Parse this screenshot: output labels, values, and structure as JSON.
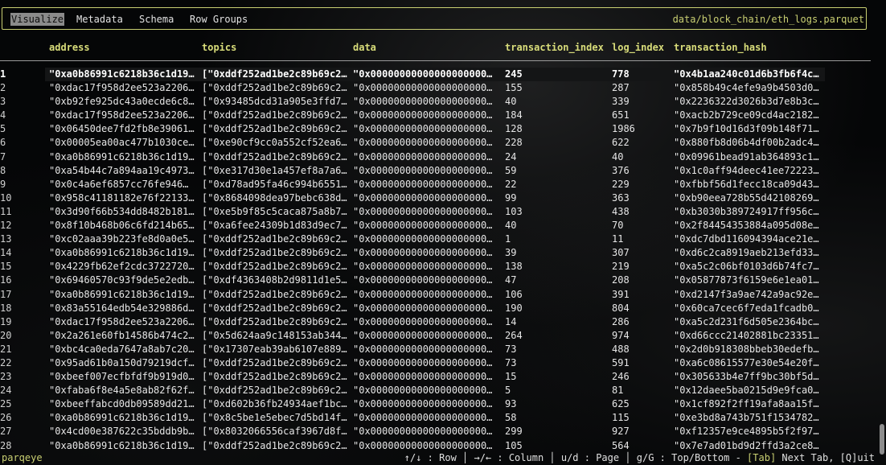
{
  "tabs": [
    {
      "label": "Visualize",
      "active": true
    },
    {
      "label": "Metadata",
      "active": false
    },
    {
      "label": "Schema",
      "active": false
    },
    {
      "label": "Row Groups",
      "active": false
    }
  ],
  "file_path": "data/block_chain/eth_logs.parquet",
  "columns": [
    "address",
    "topics",
    "data",
    "transaction_index",
    "log_index",
    "transaction_hash"
  ],
  "rows": [
    {
      "n": "1",
      "address": "\"0xa0b86991c6218b36c1d19…",
      "topics": "[\"0xddf252ad1be2c89b69c2…",
      "data": "\"0x00000000000000000000…",
      "transaction_index": "245",
      "log_index": "778",
      "transaction_hash": "\"0x4b1aa240c01d6b3fb6f4c…"
    },
    {
      "n": "2",
      "address": "\"0xdac17f958d2ee523a2206…",
      "topics": "[\"0xddf252ad1be2c89b69c2…",
      "data": "\"0x00000000000000000000…",
      "transaction_index": "155",
      "log_index": "287",
      "transaction_hash": "\"0x858b49c4efe9a9b4503d0…"
    },
    {
      "n": "3",
      "address": "\"0xb92fe925dc43a0ecde6c8…",
      "topics": "[\"0x93485dcd31a905e3ffd7…",
      "data": "\"0x00000000000000000000…",
      "transaction_index": "40",
      "log_index": "339",
      "transaction_hash": "\"0x2236322d3026b3d7e8b3c…"
    },
    {
      "n": "4",
      "address": "\"0xdac17f958d2ee523a2206…",
      "topics": "[\"0xddf252ad1be2c89b69c2…",
      "data": "\"0x00000000000000000000…",
      "transaction_index": "184",
      "log_index": "651",
      "transaction_hash": "\"0xacb2b729ce09cd4ac2182…"
    },
    {
      "n": "5",
      "address": "\"0x06450dee7fd2fb8e39061…",
      "topics": "[\"0xddf252ad1be2c89b69c2…",
      "data": "\"0x00000000000000000000…",
      "transaction_index": "128",
      "log_index": "1986",
      "transaction_hash": "\"0x7b9f10d16d3f09b148f71…"
    },
    {
      "n": "6",
      "address": "\"0x00005ea00ac477b1030ce…",
      "topics": "[\"0xe90cf9cc0a552cf52ea6…",
      "data": "\"0x00000000000000000000…",
      "transaction_index": "228",
      "log_index": "622",
      "transaction_hash": "\"0x880fb8d06b4df00b2adc4…"
    },
    {
      "n": "7",
      "address": "\"0xa0b86991c6218b36c1d19…",
      "topics": "[\"0xddf252ad1be2c89b69c2…",
      "data": "\"0x00000000000000000000…",
      "transaction_index": "24",
      "log_index": "40",
      "transaction_hash": "\"0x09961bead91ab364893c1…"
    },
    {
      "n": "8",
      "address": "\"0xa54b44c7a894aa19c4973…",
      "topics": "[\"0xe317d30e1a457ef8a7a6…",
      "data": "\"0x00000000000000000000…",
      "transaction_index": "59",
      "log_index": "376",
      "transaction_hash": "\"0x1c0aff94deec41ee72223…"
    },
    {
      "n": "9",
      "address": "\"0x0c4a6ef6857cc76fe946…",
      "topics": "[\"0xd78ad95fa46c994b6551…",
      "data": "\"0x00000000000000000000…",
      "transaction_index": "22",
      "log_index": "229",
      "transaction_hash": "\"0xfbbf56d1fecc18ca09d43…"
    },
    {
      "n": "10",
      "address": "\"0x958c41181182e76f22133…",
      "topics": "[\"0x8684098dea97bebc638d…",
      "data": "\"0x00000000000000000000…",
      "transaction_index": "99",
      "log_index": "363",
      "transaction_hash": "\"0xb90eea728b55d42108269…"
    },
    {
      "n": "11",
      "address": "\"0x3d90f66b534dd8482b181…",
      "topics": "[\"0xe5b9f85c5caca875a8b7…",
      "data": "\"0x00000000000000000000…",
      "transaction_index": "103",
      "log_index": "438",
      "transaction_hash": "\"0xb3030b389724917ff956c…"
    },
    {
      "n": "12",
      "address": "\"0x8f10b468b06c6fd214b65…",
      "topics": "[\"0xa6fee24309b1d83d9ec7…",
      "data": "\"0x00000000000000000000…",
      "transaction_index": "40",
      "log_index": "70",
      "transaction_hash": "\"0x2f84454353884a095d08e…"
    },
    {
      "n": "13",
      "address": "\"0xc02aaa39b223fe8d0a0e5…",
      "topics": "[\"0xddf252ad1be2c89b69c2…",
      "data": "\"0x00000000000000000000…",
      "transaction_index": "1",
      "log_index": "11",
      "transaction_hash": "\"0xdc7dbd116094394ace21e…"
    },
    {
      "n": "14",
      "address": "\"0xa0b86991c6218b36c1d19…",
      "topics": "[\"0xddf252ad1be2c89b69c2…",
      "data": "\"0x00000000000000000000…",
      "transaction_index": "39",
      "log_index": "307",
      "transaction_hash": "\"0xd6c2ca8919aeb213efd33…"
    },
    {
      "n": "15",
      "address": "\"0x4229fb62ef2cdc3722720…",
      "topics": "[\"0xddf252ad1be2c89b69c2…",
      "data": "\"0x00000000000000000000…",
      "transaction_index": "138",
      "log_index": "219",
      "transaction_hash": "\"0xa5c2c06bf0103d6b74fc7…"
    },
    {
      "n": "16",
      "address": "\"0x69460570c93f9de5e2edb…",
      "topics": "[\"0xdf4363408b2d9811d1e5…",
      "data": "\"0x00000000000000000000…",
      "transaction_index": "47",
      "log_index": "208",
      "transaction_hash": "\"0x05877873f6159e6e1ea01…"
    },
    {
      "n": "17",
      "address": "\"0xa0b86991c6218b36c1d19…",
      "topics": "[\"0xddf252ad1be2c89b69c2…",
      "data": "\"0x00000000000000000000…",
      "transaction_index": "106",
      "log_index": "391",
      "transaction_hash": "\"0xd2147f3a9ae742a9ac92e…"
    },
    {
      "n": "18",
      "address": "\"0x83a55164edb54e329886d…",
      "topics": "[\"0xddf252ad1be2c89b69c2…",
      "data": "\"0x00000000000000000000…",
      "transaction_index": "190",
      "log_index": "804",
      "transaction_hash": "\"0x60ca7cec6f7eda1fcadb0…"
    },
    {
      "n": "19",
      "address": "\"0xdac17f958d2ee523a2206…",
      "topics": "[\"0xddf252ad1be2c89b69c2…",
      "data": "\"0x00000000000000000000…",
      "transaction_index": "14",
      "log_index": "286",
      "transaction_hash": "\"0xa5c2d231f6d505e2364bc…"
    },
    {
      "n": "20",
      "address": "\"0x2a261e60fb14586b474c2…",
      "topics": "[\"0x5d624aa9c148153ab344…",
      "data": "\"0x00000000000000000000…",
      "transaction_index": "264",
      "log_index": "974",
      "transaction_hash": "\"0xd66ccc21402881bc23351…"
    },
    {
      "n": "21",
      "address": "\"0xbc4ca0eda7647a8ab7c20…",
      "topics": "[\"0x17307eab39ab6107e889…",
      "data": "\"0x00000000000000000000…",
      "transaction_index": "73",
      "log_index": "488",
      "transaction_hash": "\"0x2d0b918308bbeb30edefb…"
    },
    {
      "n": "22",
      "address": "\"0x95ad61b0a150d79219dcf…",
      "topics": "[\"0xddf252ad1be2c89b69c2…",
      "data": "\"0x00000000000000000000…",
      "transaction_index": "73",
      "log_index": "591",
      "transaction_hash": "\"0xa6c08615577e30e54e20f…"
    },
    {
      "n": "23",
      "address": "\"0xbeef007ecfbfdf9b919d0…",
      "topics": "[\"0xddf252ad1be2c89b69c2…",
      "data": "\"0x00000000000000000000…",
      "transaction_index": "15",
      "log_index": "246",
      "transaction_hash": "\"0x305633b4e7ff9bc30bf5d…"
    },
    {
      "n": "24",
      "address": "\"0xfaba6f8e4a5e8ab82f62f…",
      "topics": "[\"0xddf252ad1be2c89b69c2…",
      "data": "\"0x00000000000000000000…",
      "transaction_index": "5",
      "log_index": "81",
      "transaction_hash": "\"0x12daee5ba0215d9e9fca0…"
    },
    {
      "n": "25",
      "address": "\"0xbeeffabcd0db09589dd21…",
      "topics": "[\"0xd602b36fb24934aef1bc…",
      "data": "\"0x00000000000000000000…",
      "transaction_index": "93",
      "log_index": "625",
      "transaction_hash": "\"0x1cf892f2ff19afa8aa15f…"
    },
    {
      "n": "26",
      "address": "\"0xa0b86991c6218b36c1d19…",
      "topics": "[\"0x8c5be1e5ebec7d5bd14f…",
      "data": "\"0x00000000000000000000…",
      "transaction_index": "58",
      "log_index": "115",
      "transaction_hash": "\"0xe3bd8a743b751f1534782…"
    },
    {
      "n": "27",
      "address": "\"0x4cd00e387622c35bddb9b…",
      "topics": "[\"0x8032066556caf3967d8f…",
      "data": "\"0x00000000000000000000…",
      "transaction_index": "299",
      "log_index": "927",
      "transaction_hash": "\"0xf12357e9ce4895b5f2f97…"
    },
    {
      "n": "28",
      "address": "\"0xa0b86991c6218b36c1d19…",
      "topics": "[\"0xddf252ad1be2c89b69c2…",
      "data": "\"0x00000000000000000000…",
      "transaction_index": "105",
      "log_index": "564",
      "transaction_hash": "\"0x7e7ad01bd9d2ffd3a2ce8…"
    }
  ],
  "status": {
    "app_name": "parqeye",
    "help_prefix": "↑/↓ : Row │ →/← : Column │ u/d : Page │ g/G : Top/Bottom - ",
    "tab_key": "[Tab]",
    "help_suffix": " Next Tab, [Q]uit"
  }
}
